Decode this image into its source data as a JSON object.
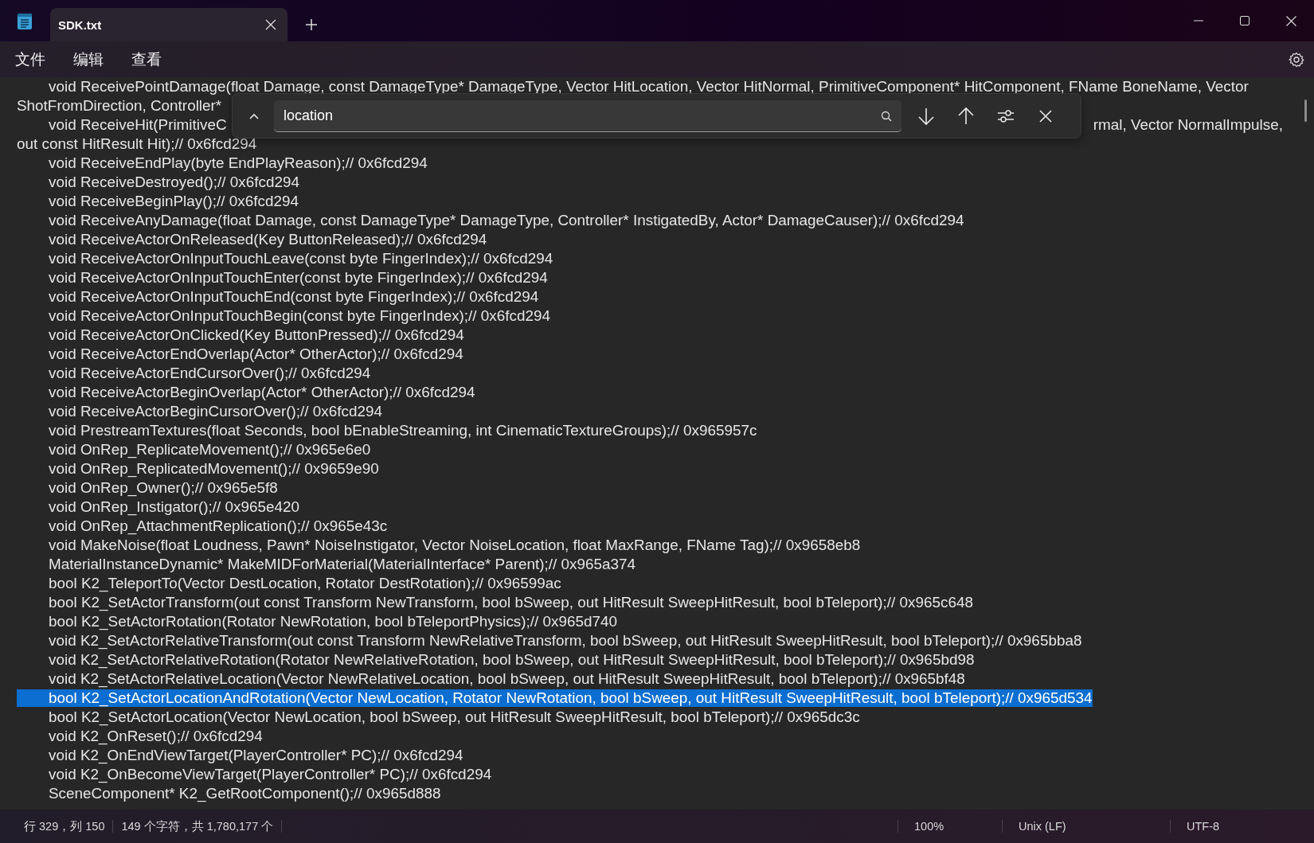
{
  "window": {
    "tabs": [
      {
        "title": "SDK.txt",
        "selected": true
      }
    ]
  },
  "menu": [
    "文件",
    "编辑",
    "查看"
  ],
  "find": {
    "value": "location"
  },
  "lines": [
    {
      "kind": "code",
      "text": "void ReceivePointDamage(float Damage, const DamageType* DamageType, Vector HitLocation, Vector HitNormal, PrimitiveComponent* HitComponent, FName BoneName, Vector",
      "selected": false
    },
    {
      "kind": "wrap",
      "text": "ShotFromDirection, Controller*",
      "selected": false
    },
    {
      "kind": "code",
      "text": "void ReceiveHit(PrimitiveC",
      "text_right": "rmal, Vector NormalImpulse,",
      "selected": false
    },
    {
      "kind": "wrap",
      "text": "out const HitResult Hit);// 0x6fcd294",
      "selected": false
    },
    {
      "kind": "code",
      "text": "void ReceiveEndPlay(byte EndPlayReason);// 0x6fcd294",
      "selected": false
    },
    {
      "kind": "code",
      "text": "void ReceiveDestroyed();// 0x6fcd294",
      "selected": false
    },
    {
      "kind": "code",
      "text": "void ReceiveBeginPlay();// 0x6fcd294",
      "selected": false
    },
    {
      "kind": "code",
      "text": "void ReceiveAnyDamage(float Damage, const DamageType* DamageType, Controller* InstigatedBy, Actor* DamageCauser);// 0x6fcd294",
      "selected": false
    },
    {
      "kind": "code",
      "text": "void ReceiveActorOnReleased(Key ButtonReleased);// 0x6fcd294",
      "selected": false
    },
    {
      "kind": "code",
      "text": "void ReceiveActorOnInputTouchLeave(const byte FingerIndex);// 0x6fcd294",
      "selected": false
    },
    {
      "kind": "code",
      "text": "void ReceiveActorOnInputTouchEnter(const byte FingerIndex);// 0x6fcd294",
      "selected": false
    },
    {
      "kind": "code",
      "text": "void ReceiveActorOnInputTouchEnd(const byte FingerIndex);// 0x6fcd294",
      "selected": false
    },
    {
      "kind": "code",
      "text": "void ReceiveActorOnInputTouchBegin(const byte FingerIndex);// 0x6fcd294",
      "selected": false
    },
    {
      "kind": "code",
      "text": "void ReceiveActorOnClicked(Key ButtonPressed);// 0x6fcd294",
      "selected": false
    },
    {
      "kind": "code",
      "text": "void ReceiveActorEndOverlap(Actor* OtherActor);// 0x6fcd294",
      "selected": false
    },
    {
      "kind": "code",
      "text": "void ReceiveActorEndCursorOver();// 0x6fcd294",
      "selected": false
    },
    {
      "kind": "code",
      "text": "void ReceiveActorBeginOverlap(Actor* OtherActor);// 0x6fcd294",
      "selected": false
    },
    {
      "kind": "code",
      "text": "void ReceiveActorBeginCursorOver();// 0x6fcd294",
      "selected": false
    },
    {
      "kind": "code",
      "text": "void PrestreamTextures(float Seconds, bool bEnableStreaming, int CinematicTextureGroups);// 0x965957c",
      "selected": false
    },
    {
      "kind": "code",
      "text": "void OnRep_ReplicateMovement();// 0x965e6e0",
      "selected": false
    },
    {
      "kind": "code",
      "text": "void OnRep_ReplicatedMovement();// 0x9659e90",
      "selected": false
    },
    {
      "kind": "code",
      "text": "void OnRep_Owner();// 0x965e5f8",
      "selected": false
    },
    {
      "kind": "code",
      "text": "void OnRep_Instigator();// 0x965e420",
      "selected": false
    },
    {
      "kind": "code",
      "text": "void OnRep_AttachmentReplication();// 0x965e43c",
      "selected": false
    },
    {
      "kind": "code",
      "text": "void MakeNoise(float Loudness, Pawn* NoiseInstigator, Vector NoiseLocation, float MaxRange, FName Tag);// 0x9658eb8",
      "selected": false
    },
    {
      "kind": "code",
      "text": "MaterialInstanceDynamic* MakeMIDForMaterial(MaterialInterface* Parent);// 0x965a374",
      "selected": false
    },
    {
      "kind": "code",
      "text": "bool K2_TeleportTo(Vector DestLocation, Rotator DestRotation);// 0x96599ac",
      "selected": false
    },
    {
      "kind": "code",
      "text": "bool K2_SetActorTransform(out const Transform NewTransform, bool bSweep, out HitResult SweepHitResult, bool bTeleport);// 0x965c648",
      "selected": false
    },
    {
      "kind": "code",
      "text": "bool K2_SetActorRotation(Rotator NewRotation, bool bTeleportPhysics);// 0x965d740",
      "selected": false
    },
    {
      "kind": "code",
      "text": "void K2_SetActorRelativeTransform(out const Transform NewRelativeTransform, bool bSweep, out HitResult SweepHitResult, bool bTeleport);// 0x965bba8",
      "selected": false
    },
    {
      "kind": "code",
      "text": "void K2_SetActorRelativeRotation(Rotator NewRelativeRotation, bool bSweep, out HitResult SweepHitResult, bool bTeleport);// 0x965bd98",
      "selected": false
    },
    {
      "kind": "code",
      "text": "void K2_SetActorRelativeLocation(Vector NewRelativeLocation, bool bSweep, out HitResult SweepHitResult, bool bTeleport);// 0x965bf48",
      "selected": false
    },
    {
      "kind": "code",
      "text": "bool K2_SetActorLocationAndRotation(Vector NewLocation, Rotator NewRotation, bool bSweep, out HitResult SweepHitResult, bool bTeleport);// 0x965d534",
      "selected": true
    },
    {
      "kind": "code",
      "text": "bool K2_SetActorLocation(Vector NewLocation, bool bSweep, out HitResult SweepHitResult, bool bTeleport);// 0x965dc3c",
      "selected": false
    },
    {
      "kind": "code",
      "text": "void K2_OnReset();// 0x6fcd294",
      "selected": false
    },
    {
      "kind": "code",
      "text": "void K2_OnEndViewTarget(PlayerController* PC);// 0x6fcd294",
      "selected": false
    },
    {
      "kind": "code",
      "text": "void K2_OnBecomeViewTarget(PlayerController* PC);// 0x6fcd294",
      "selected": false
    },
    {
      "kind": "code",
      "text": "SceneComponent* K2_GetRootComponent();// 0x965d888",
      "selected": false
    }
  ],
  "status_bar": {
    "position": "行 329，列 150",
    "selection": "149 个字符，共 1,780,177 个",
    "zoom": "100%",
    "line_ending": "Unix (LF)",
    "encoding": "UTF-8"
  }
}
